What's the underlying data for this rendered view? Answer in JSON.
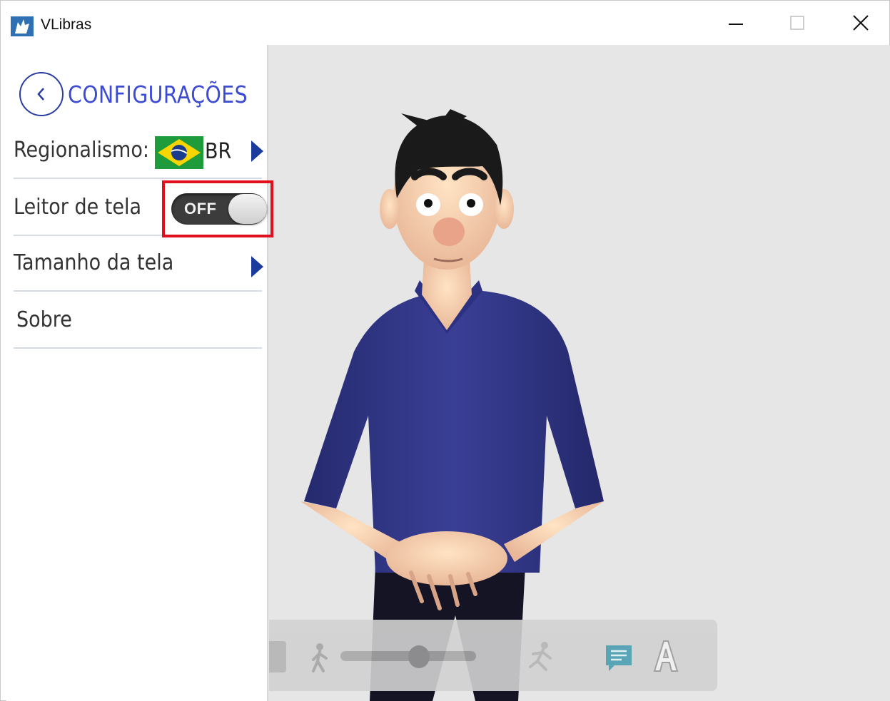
{
  "window": {
    "title": "VLibras",
    "controls": [
      "minimize",
      "maximize",
      "close"
    ]
  },
  "settings": {
    "title": "CONFIGURAÇÕES",
    "back_icon": "back-chevron-icon",
    "items": [
      {
        "label": "Regionalismo:",
        "value": "BR",
        "flag": "brazil-flag",
        "icon": "chevron-right-icon"
      },
      {
        "label": "Leitor de tela",
        "toggle": {
          "state": "OFF",
          "on": false
        }
      },
      {
        "label": "Tamanho da tela",
        "icon": "chevron-right-icon"
      },
      {
        "label": "Sobre"
      }
    ]
  },
  "controls": {
    "icons": [
      "stop-icon",
      "slow-walk-icon",
      "speed-slider",
      "fast-run-icon",
      "subtitle-icon",
      "text-icon"
    ],
    "subtitle_color": "#4a9fb0"
  },
  "colors": {
    "accent": "#3b4bd4",
    "chevron": "#1a3b9c",
    "highlight": "#e0101e",
    "stage": "#e6e6e6"
  }
}
